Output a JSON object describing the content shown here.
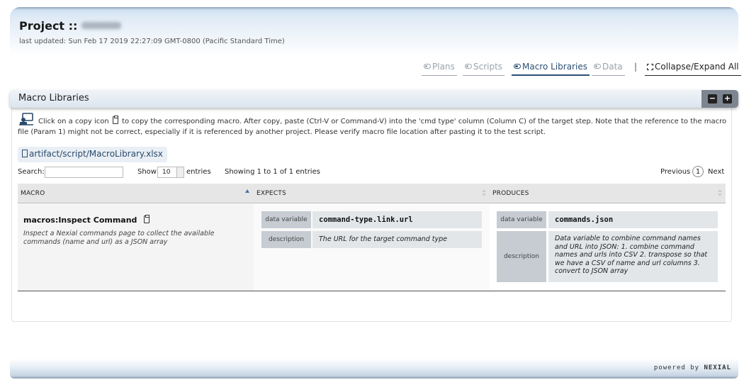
{
  "header": {
    "title_prefix": "Project ::",
    "last_updated": "last updated: Sun Feb 17 2019 22:27:09 GMT-0800 (Pacific Standard Time)"
  },
  "nav": {
    "items": [
      {
        "label": "Plans",
        "state": "inactive"
      },
      {
        "label": "Scripts",
        "state": "inactive"
      },
      {
        "label": "Macro Libraries",
        "state": "active"
      },
      {
        "label": "Data",
        "state": "inactive"
      }
    ],
    "separator": "|",
    "collapse_expand": "Collapse/Expand All"
  },
  "section": {
    "title": "Macro Libraries",
    "collapse_symbol": "−",
    "expand_symbol": "+",
    "info_before_icon": "Click on a copy icon",
    "info_after_icon": "to copy the corresponding macro. After copy, paste (Ctrl-V or Command-V) into the 'cmd type' column (Column C) of the target step. Note that the reference to the macro file (Param 1) might not be correct, especially if it is referenced by another project. Please verify macro file location after pasting it to the test script.",
    "file_link": "artifact/script/MacroLibrary.xlsx"
  },
  "table_controls": {
    "search_label": "Search:",
    "search_value": "",
    "show_label": "Show",
    "page_length": "10",
    "entries_label": "entries",
    "showing": "Showing 1 to 1 of 1 entries",
    "previous": "Previous",
    "current_page": "1",
    "next": "Next"
  },
  "table": {
    "columns": [
      "MACRO",
      "EXPECTS",
      "PRODUCES"
    ],
    "rows": [
      {
        "macro_name": "macros:Inspect Command",
        "macro_description": "Inspect a Nexial commands page to collect the available commands (name and url) as a JSON array",
        "expects": {
          "data_variable_label": "data variable",
          "data_variable": "command-type.link.url",
          "description_label": "description",
          "description": "The URL for the target command type"
        },
        "produces": {
          "data_variable_label": "data variable",
          "data_variable": "commands.json",
          "description_label": "description",
          "description": "Data variable to combine command names and URL into JSON: 1. combine command names and urls into CSV 2. transpose so that we have a CSV of name and url columns 3. convert to JSON array"
        }
      }
    ]
  },
  "footer": {
    "powered_by": "powered by",
    "brand": "NEXIAL"
  }
}
